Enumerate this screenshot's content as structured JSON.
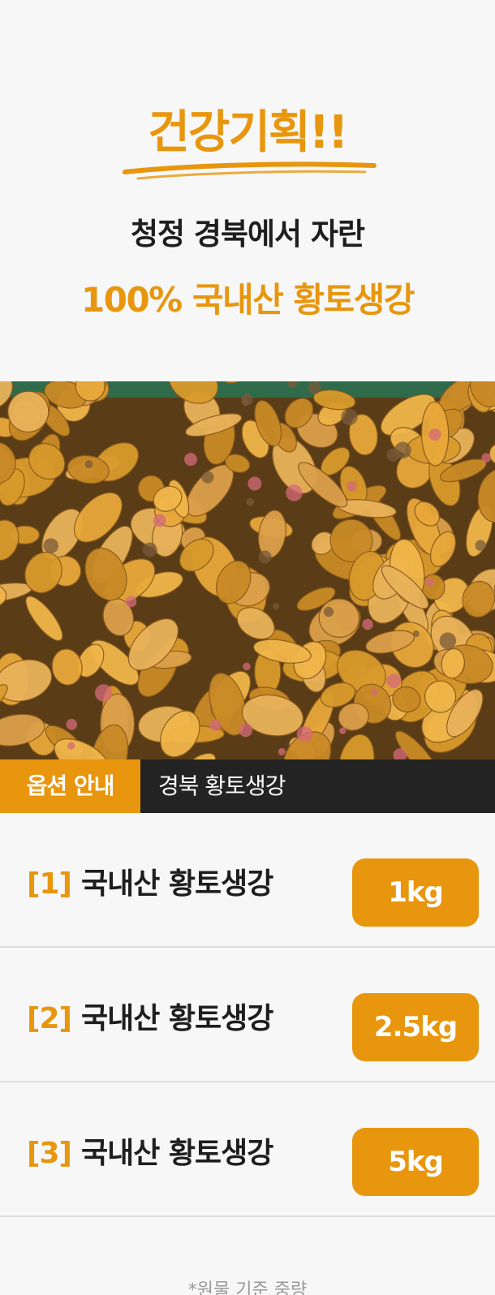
{
  "header": {
    "headline": "건강기획!!",
    "subline1": "청정 경북에서 자란",
    "subline2": "100% 국내산 황토생강"
  },
  "photo": {
    "description_icon": "ginger-photo"
  },
  "option_bar": {
    "tab_label": "옵션 안내",
    "product_label": "경북 황토생강"
  },
  "options": [
    {
      "number": "[1]",
      "name": "국내산 황토생강",
      "weight": "1kg"
    },
    {
      "number": "[2]",
      "name": "국내산 황토생강",
      "weight": "2.5kg"
    },
    {
      "number": "[3]",
      "name": "국내산 황토생강",
      "weight": "5kg"
    }
  ],
  "footnote": "*원물 기준 중량",
  "colors": {
    "accent": "#e8960e",
    "dark": "#232323",
    "background": "#f7f7f7"
  }
}
